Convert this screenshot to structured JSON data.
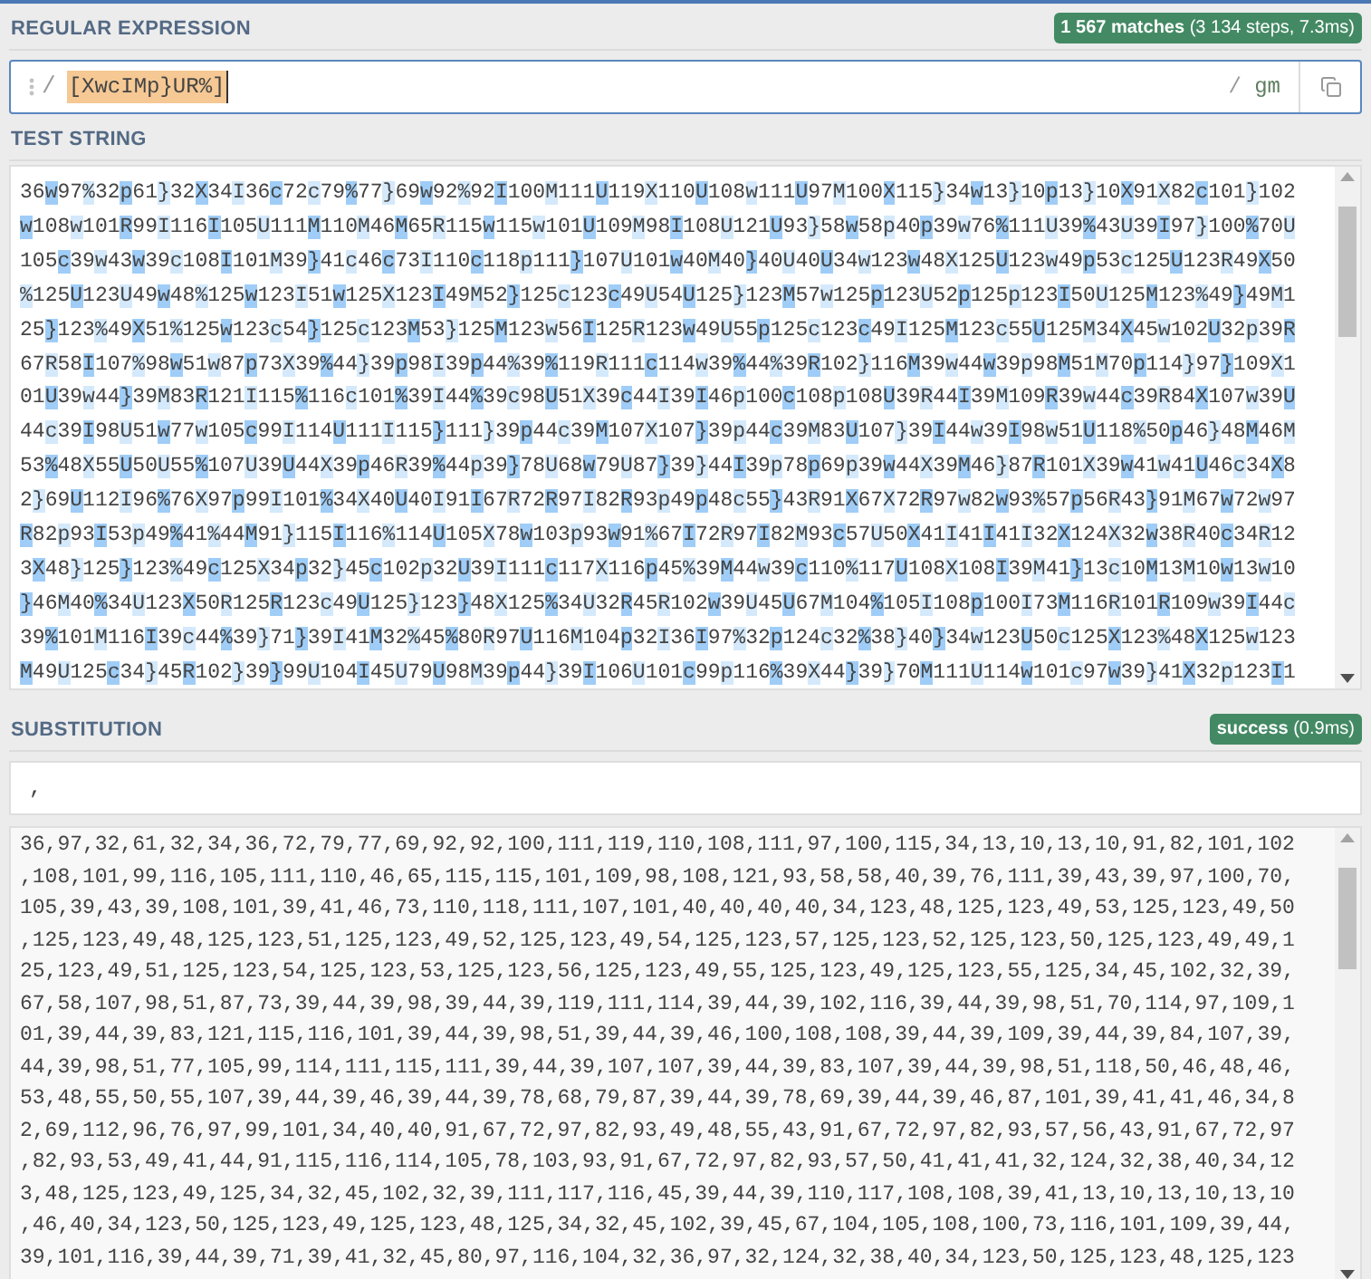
{
  "regex_section": {
    "title": "REGULAR EXPRESSION",
    "match_info": "**1 567 matches** (3 134 steps, 7.3ms)",
    "delimiter_open": "/",
    "pattern": "[XwcIMp}UR%]",
    "delimiter_close": "/",
    "flags": "gm"
  },
  "test_string": {
    "title": "TEST STRING",
    "lines": [
      "36w97%32p61}32X34I36c72c79%77}69w92%92I100M111U119X110U108w111U97M100X115}34w13}10p13}10X91X82c101}102",
      "w108w101R99I116I105U111M110M46M65R115w115w101U109M98I108U121U93}58w58p40p39w76%111U39%43U39I97}100%70U",
      "105c39w43w39c108I101M39}41c46c73I110c118p111}107U101w40M40}40U40U34w123w48X125U123w49p53c125U123R49X50",
      "%125U123U49w48%125w123I51w125X123I49M52}125c123c49U54U125}123M57w125p123U52p125p123I50U125M123%49}49M1",
      "25}123%49X51%125w123c54}125c123M53}125M123w56I125R123w49U55p125c123c49I125M123c55U125M34X45w102U32p39R",
      "67R58I107%98w51w87p73X39%44}39p98I39p44%39%119R111c114w39%44%39R102}116M39w44w39p98M51M70p114}97}109X1",
      "01U39w44}39M83R121I115%116c101%39I44%39c98U51X39c44I39I46p100c108p108U39R44I39M109R39w44c39R84X107w39U",
      "44c39I98U51w77w105c99I114U111I115}111}39p44c39M107X107}39p44c39M83U107}39I44w39I98w51U118%50p46}48M46M",
      "53%48X55U50U55%107U39U44X39p46R39%44p39}78U68w79U87}39}44I39p78p69p39w44X39M46}87R101X39w41w41U46c34X8",
      "2}69U112I96%76X97p99I101%34X40U40I91I67R72R97I82R93p49p48c55}43R91X67X72R97w82w93%57p56R43}91M67w72w97",
      "R82p93I53p49%41%44M91}115I116%114U105X78w103p93w91%67I72R97I82M93c57U50X41I41I41I32X124X32w38R40c34R12",
      "3X48}125}123%49c125X34p32}45c102p32U39I111c117X116p45%39M44w39c110%117U108X108I39M41}13c10M13M10w13w10",
      "}46M40%34U123X50R125R123c49U125}123}48X125%34U32R45R102w39U45U67M104%105I108p100I73M116R101R109w39I44c",
      "39%101M116I39c44%39}71}39I41M32%45%80R97U116M104p32I36I97%32p124c32%38}40}34w123U50c125X123%48X125w123",
      "M49U125c34}45R102}39}99U104I45U79U98M39p44}39I106U101c99p116%39X44}39}70M111U114w101c97w39}41X32p123I1"
    ]
  },
  "substitution": {
    "title": "SUBSTITUTION",
    "status": "**success** (0.9ms)",
    "value": ",",
    "result_lines": [
      "36,97,32,61,32,34,36,72,79,77,69,92,92,100,111,119,110,108,111,97,100,115,34,13,10,13,10,91,82,101,102",
      ",108,101,99,116,105,111,110,46,65,115,115,101,109,98,108,121,93,58,58,40,39,76,111,39,43,39,97,100,70,",
      "105,39,43,39,108,101,39,41,46,73,110,118,111,107,101,40,40,40,40,34,123,48,125,123,49,53,125,123,49,50",
      ",125,123,49,48,125,123,51,125,123,49,52,125,123,49,54,125,123,57,125,123,52,125,123,50,125,123,49,49,1",
      "25,123,49,51,125,123,54,125,123,53,125,123,56,125,123,49,55,125,123,49,125,123,55,125,34,45,102,32,39,",
      "67,58,107,98,51,87,73,39,44,39,98,39,44,39,119,111,114,39,44,39,102,116,39,44,39,98,51,70,114,97,109,1",
      "01,39,44,39,83,121,115,116,101,39,44,39,98,51,39,44,39,46,100,108,108,39,44,39,109,39,44,39,84,107,39,",
      "44,39,98,51,77,105,99,114,111,115,111,39,44,39,107,107,39,44,39,83,107,39,44,39,98,51,118,50,46,48,46,",
      "53,48,55,50,55,107,39,44,39,46,39,44,39,78,68,79,87,39,44,39,78,69,39,44,39,46,87,101,39,41,41,46,34,8",
      "2,69,112,96,76,97,99,101,34,40,40,91,67,72,97,82,93,49,48,55,43,91,67,72,97,82,93,57,56,43,91,67,72,97",
      ",82,93,53,49,41,44,91,115,116,114,105,78,103,93,91,67,72,97,82,93,57,50,41,41,41,32,124,32,38,40,34,12",
      "3,48,125,123,49,125,34,32,45,102,32,39,111,117,116,45,39,44,39,110,117,108,108,39,41,13,10,13,10,13,10",
      ",46,40,34,123,50,125,123,49,125,123,48,125,34,32,45,102,39,45,67,104,105,108,100,73,116,101,109,39,44,",
      "39,101,116,39,44,39,71,39,41,32,45,80,97,116,104,32,36,97,32,124,32,38,40,34,123,50,125,123,48,125,123"
    ]
  }
}
